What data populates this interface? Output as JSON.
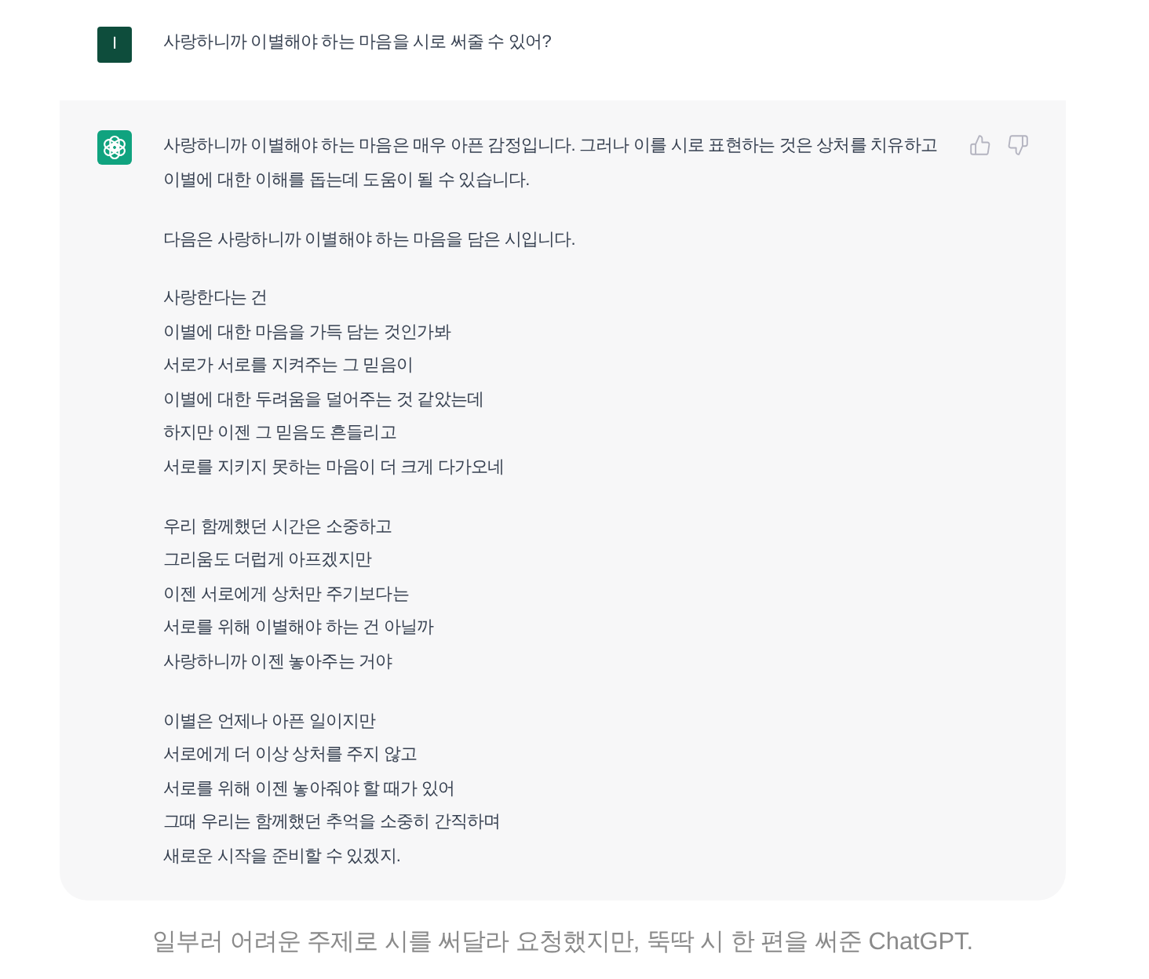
{
  "messages": [
    {
      "kind": "user",
      "avatar_letter": "I",
      "text": "사랑하니까 이별해야 하는 마음을 시로 써줄 수 있어?"
    },
    {
      "kind": "assistant",
      "paragraphs": [
        "사랑하니까 이별해야 하는 마음은 매우 아픈 감정입니다. 그러나 이를 시로 표현하는 것은 상처를 치유하고 이별에 대한 이해를 돕는데 도움이 될 수 있습니다.",
        "다음은 사랑하니까 이별해야 하는 마음을 담은 시입니다."
      ],
      "poem": [
        {
          "lines": [
            "사랑한다는 건",
            "이별에 대한 마음을 가득 담는 것인가봐",
            "서로가 서로를 지켜주는 그 믿음이",
            "이별에 대한 두려움을 덜어주는 것 같았는데",
            "하지만 이젠 그 믿음도 흔들리고",
            "서로를 지키지 못하는 마음이 더 크게 다가오네"
          ]
        },
        {
          "lines": [
            "우리 함께했던 시간은 소중하고",
            "그리움도 더럽게 아프겠지만",
            "이젠 서로에게 상처만 주기보다는",
            "서로를 위해 이별해야 하는 건 아닐까",
            "사랑하니까 이젠 놓아주는 거야"
          ]
        },
        {
          "lines": [
            "이별은 언제나 아픈 일이지만",
            "서로에게 더 이상 상처를 주지 않고",
            "서로를 위해 이젠 놓아줘야 할 때가 있어",
            "그때 우리는 함께했던 추억을 소중히 간직하며",
            "새로운 시작을 준비할 수 있겠지."
          ]
        }
      ]
    }
  ],
  "caption": "일부러 어려운 주제로 시를 써달라 요청했지만, 뚝딱 시 한 편을 써준 ChatGPT."
}
